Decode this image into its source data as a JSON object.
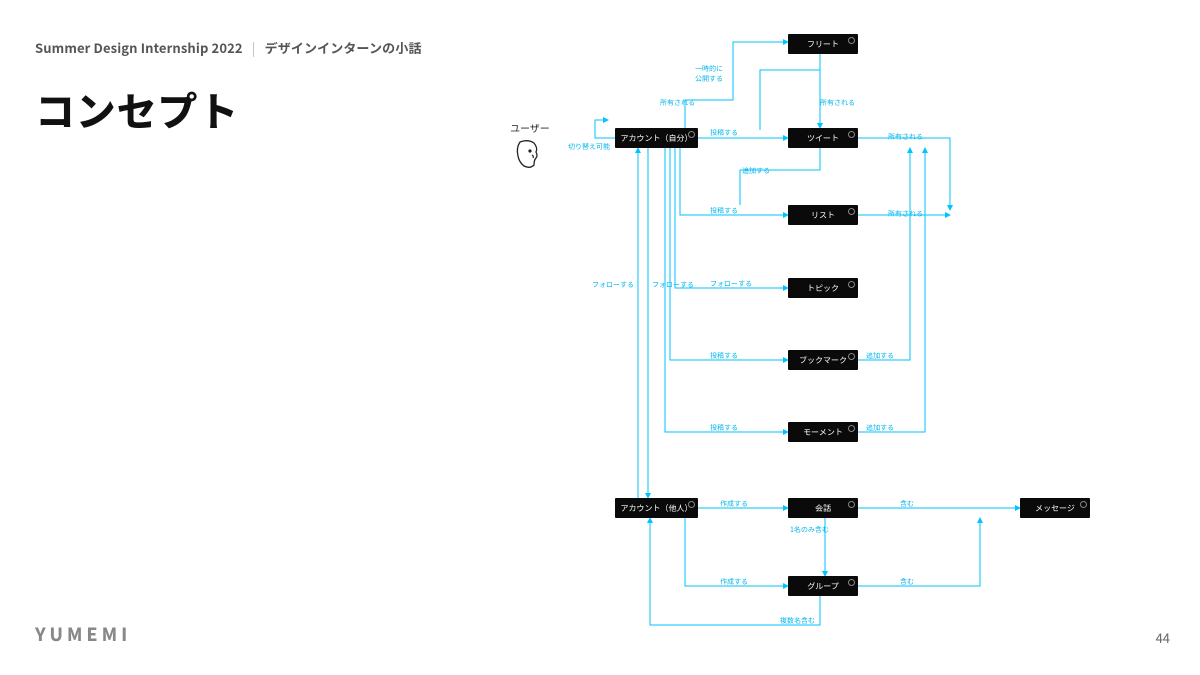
{
  "header": {
    "left": "Summer Design Internship 2022",
    "sep": "|",
    "right": "デザインインターンの小話"
  },
  "title": "コンセプト",
  "logo": "YUMEMI",
  "page_number": "44",
  "user_label": "ユーザー",
  "nodes": {
    "fleet": "フリート",
    "account_self": "アカウント（自分）",
    "tweet": "ツイート",
    "list": "リスト",
    "topic": "トピック",
    "bookmark": "ブックマーク",
    "moment": "モーメント",
    "account_other": "アカウント（他人）",
    "conversation": "会話",
    "message": "メッセージ",
    "group": "グループ"
  },
  "edges": {
    "switchable": "切り替え可能",
    "temp_public": "一時的に\n公開する",
    "shared": "所有される",
    "owned1": "所有される",
    "owned2": "所有される",
    "owned3": "所有される",
    "publish1": "投稿する",
    "publish2": "投稿する",
    "publish3": "投稿する",
    "publish4": "投稿する",
    "add": "追加する",
    "add2": "追加する",
    "add3": "追加する",
    "follow1": "フォローする",
    "follow2": "フォローする",
    "follow3": "フォローする",
    "create1": "作成する",
    "create2": "作成する",
    "contain1": "含む",
    "contain2": "含む",
    "contain_one": "1名のみ含む",
    "contain_many": "複数名含む"
  }
}
